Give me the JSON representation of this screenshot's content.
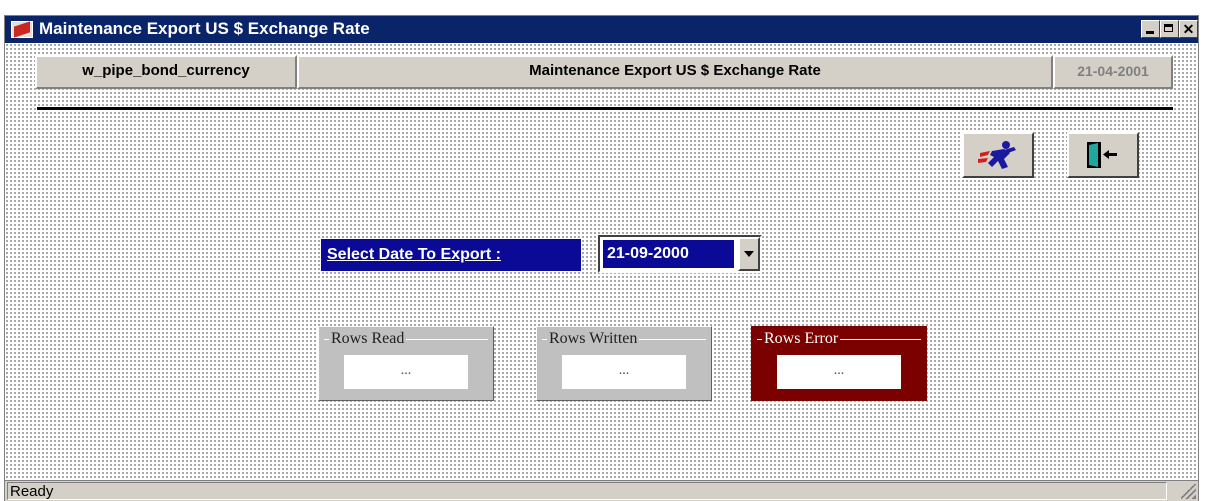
{
  "window": {
    "title": "Maintenance Export US $ Exchange Rate"
  },
  "header": {
    "left": "w_pipe_bond_currency",
    "center": "Maintenance Export US $ Exchange Rate",
    "right": "21-04-2001"
  },
  "toolbar": {
    "run_icon": "running-man-icon",
    "exit_icon": "exit-door-icon"
  },
  "form": {
    "select_label": "Select Date To Export :",
    "date_value": "21-09-2000"
  },
  "groups": {
    "rows_read": {
      "title": "Rows Read",
      "value": "..."
    },
    "rows_written": {
      "title": "Rows Written",
      "value": "..."
    },
    "rows_error": {
      "title": "Rows Error",
      "value": "..."
    }
  },
  "status": {
    "text": "Ready"
  },
  "colors": {
    "titlebar": "#0a246a",
    "label_bg": "#0a0a96",
    "error_bg": "#7b0000",
    "window_bg": "#d4d0c8"
  }
}
